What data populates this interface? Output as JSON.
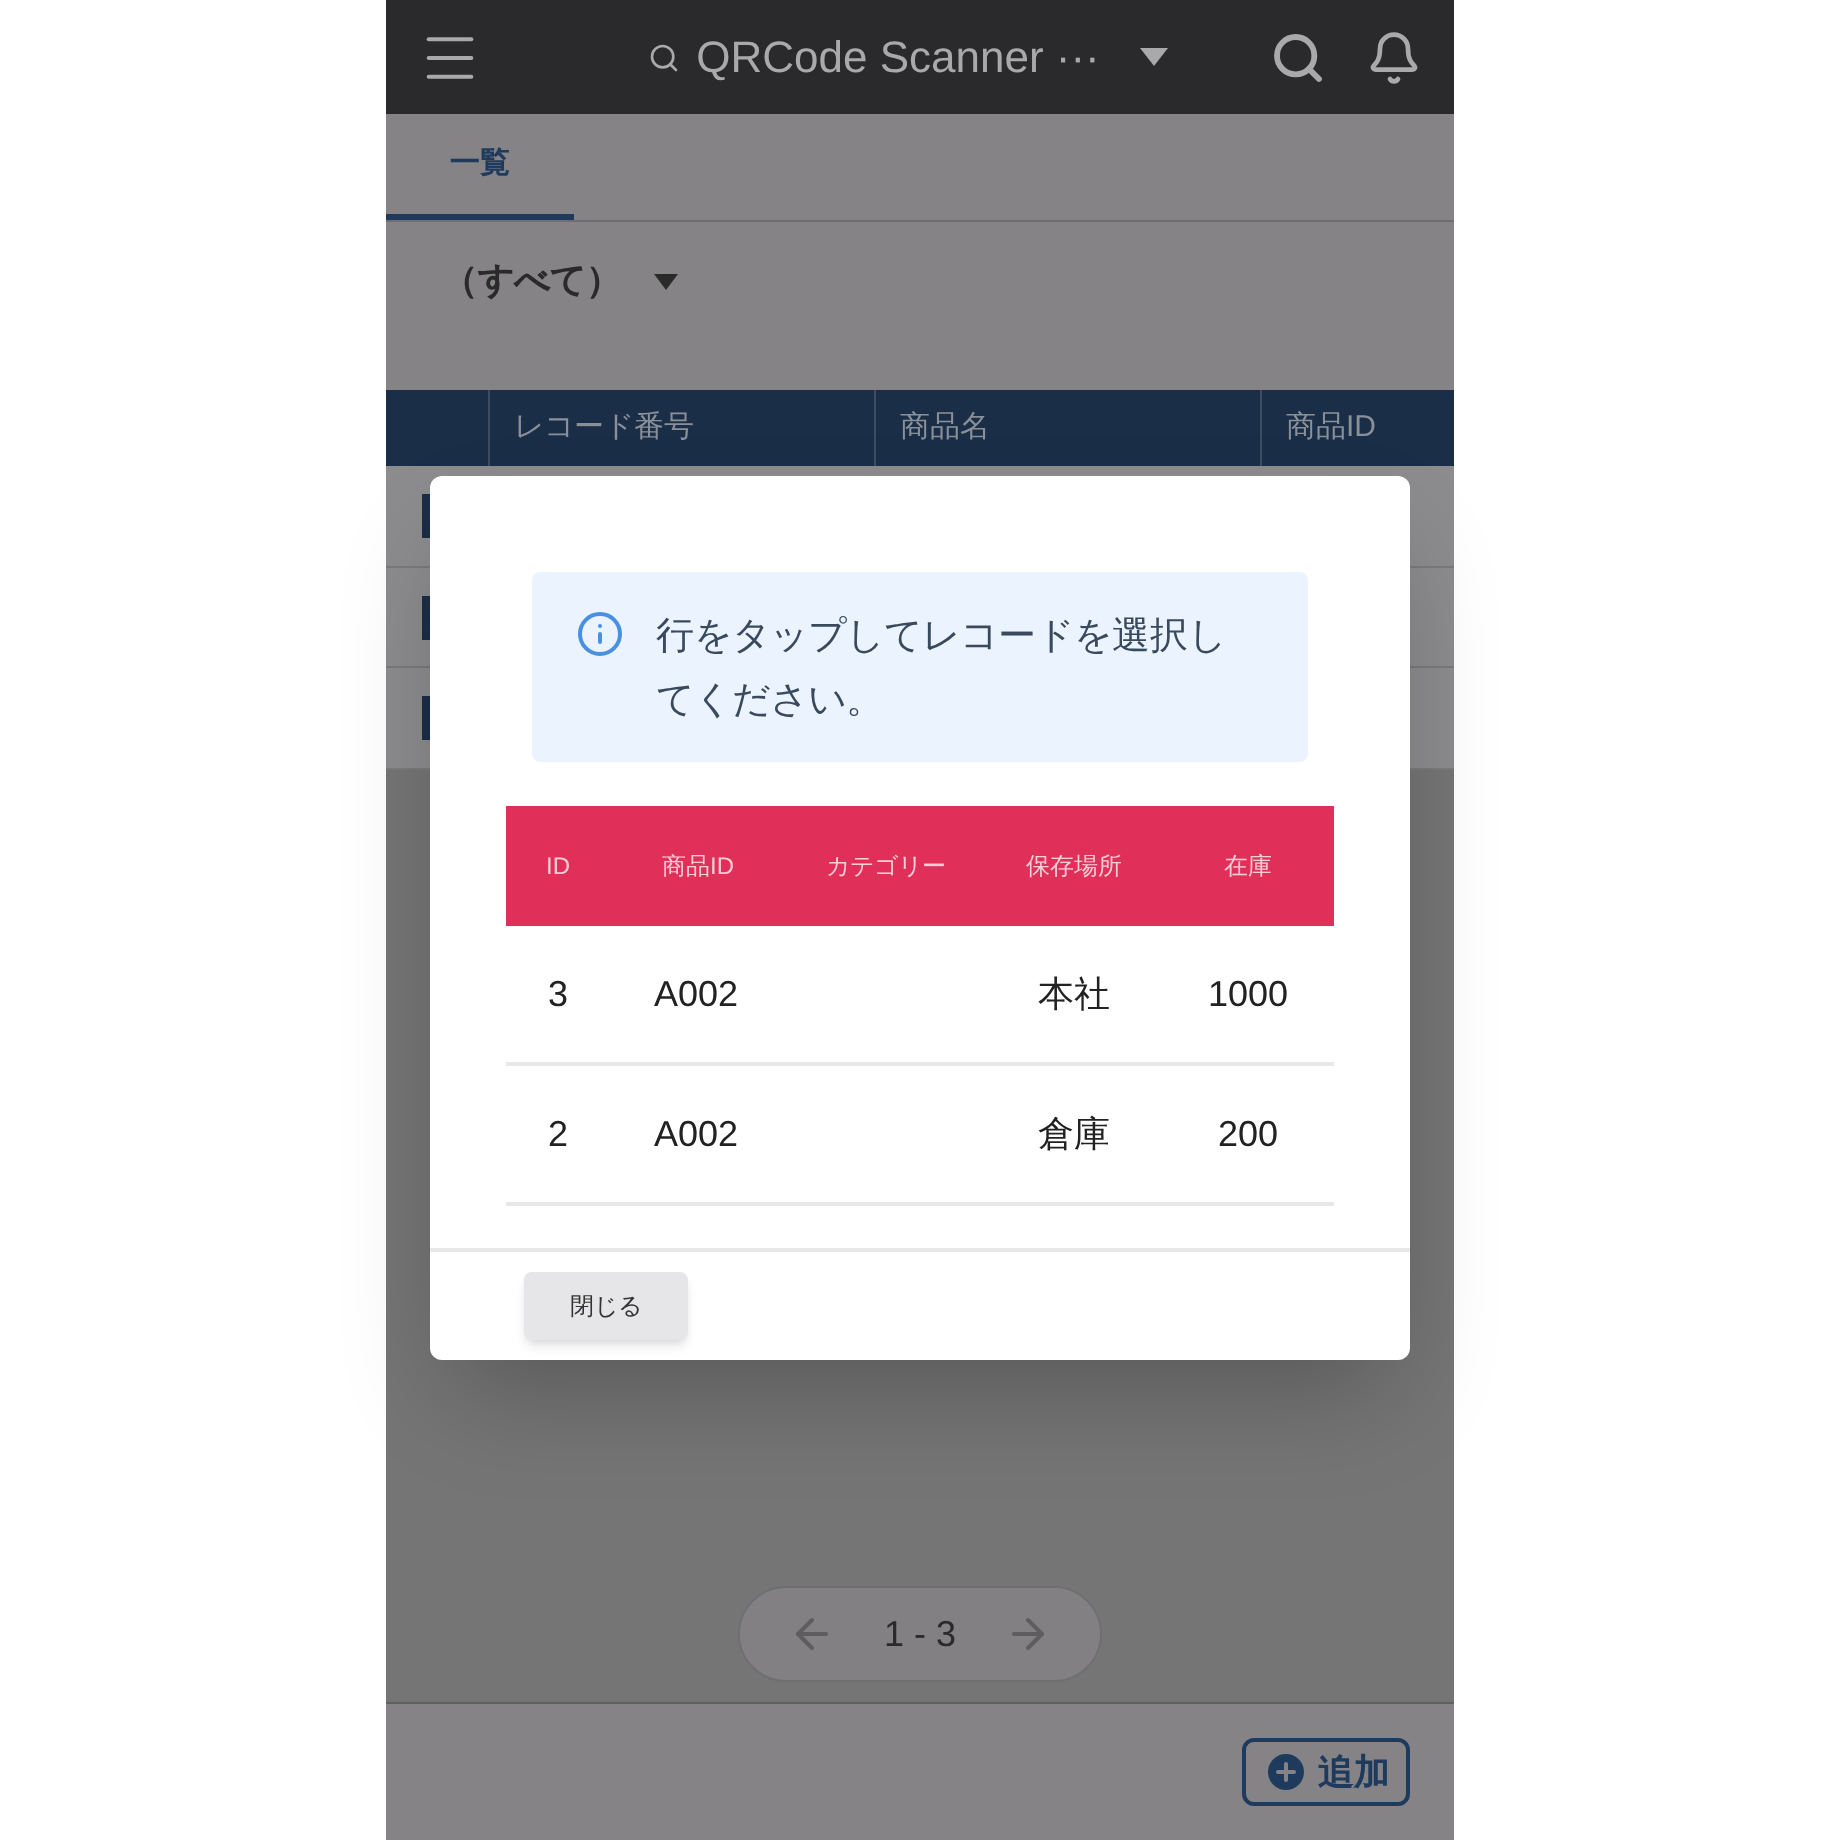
{
  "app_bar": {
    "title": "QRCode Scanner ···"
  },
  "tabs": [
    {
      "label": "一覧",
      "selected": true
    }
  ],
  "filter": {
    "value": "（すべて）"
  },
  "table": {
    "columns": [
      "レコード番号",
      "商品名",
      "商品ID"
    ]
  },
  "pagination": {
    "range": "1 - 3"
  },
  "add_button": {
    "label": "追加"
  },
  "dialog": {
    "info": "行をタップしてレコードを選択してください。",
    "columns": [
      "ID",
      "商品ID",
      "カテゴリー",
      "保存場所",
      "在庫"
    ],
    "rows": [
      [
        "3",
        "A002",
        "",
        "本社",
        "1000"
      ],
      [
        "2",
        "A002",
        "",
        "倉庫",
        "200"
      ]
    ],
    "close_button": "閉じる"
  }
}
